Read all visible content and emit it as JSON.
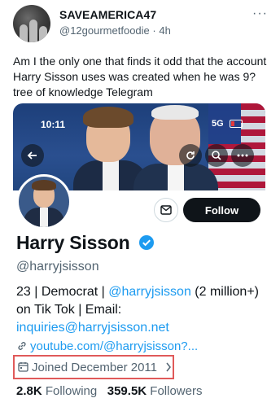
{
  "tweet": {
    "display_name": "SAVEAMERICA47",
    "handle": "@12gourmetfoodie",
    "separator": "·",
    "time": "4h",
    "more": "···",
    "text": "Am I the only one that finds it odd that the account Harry Sisson uses was created when he was 9? tree of knowledge Telegram"
  },
  "screenshot": {
    "status_time": "10:11",
    "status_network": "5G",
    "profile": {
      "name": "Harry Sisson",
      "handle": "@harryjsisson",
      "bio_prefix": "23 | Democrat | ",
      "bio_link": "@harryjsisson",
      "bio_suffix": " (2 million+) on Tik Tok | Email: ",
      "bio_email": "inquiries@harryjsisson.net",
      "url": "youtube.com/@harryjsisson?...",
      "joined": "Joined December 2011",
      "following_count": "2.8K",
      "following_label": "Following",
      "followers_count": "359.5K",
      "followers_label": "Followers"
    },
    "follow_label": "Follow"
  }
}
